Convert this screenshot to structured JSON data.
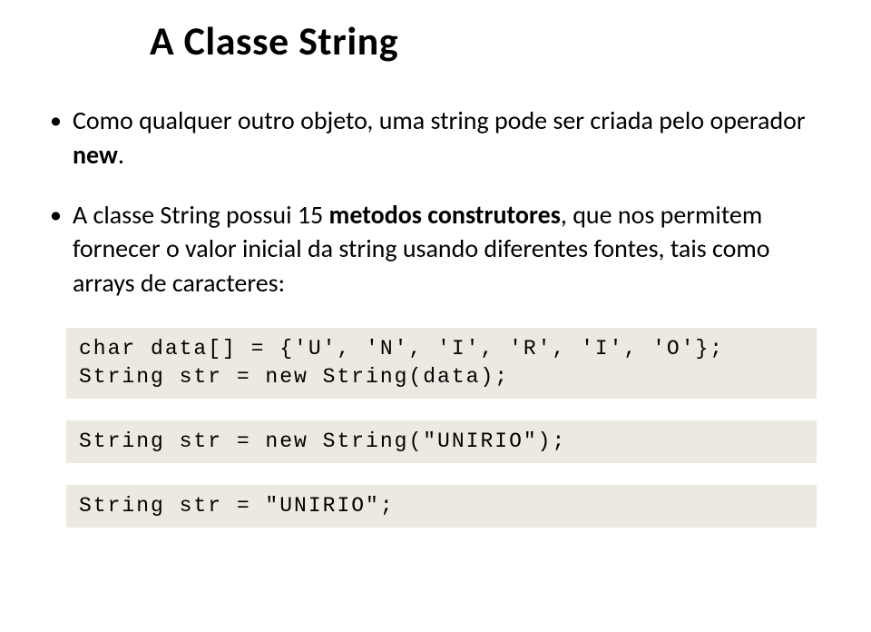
{
  "title": "A Classe String",
  "bullets": [
    {
      "segments": [
        {
          "text": "Como qualquer outro objeto, uma string pode ser criada pelo operador ",
          "bold": false
        },
        {
          "text": "new",
          "bold": true
        },
        {
          "text": ".",
          "bold": false
        }
      ]
    },
    {
      "segments": [
        {
          "text": "A classe String possui 15 ",
          "bold": false
        },
        {
          "text": "metodos construtores",
          "bold": true
        },
        {
          "text": ", que nos permitem fornecer o valor inicial da string usando diferentes fontes, tais como arrays de caracteres:",
          "bold": false
        }
      ]
    }
  ],
  "code_blocks": [
    "char data[] = {'U', 'N', 'I', 'R', 'I', 'O'};\nString str = new String(data);",
    "String str = new String(\"UNIRIO\");",
    "String str = \"UNIRIO\";"
  ]
}
